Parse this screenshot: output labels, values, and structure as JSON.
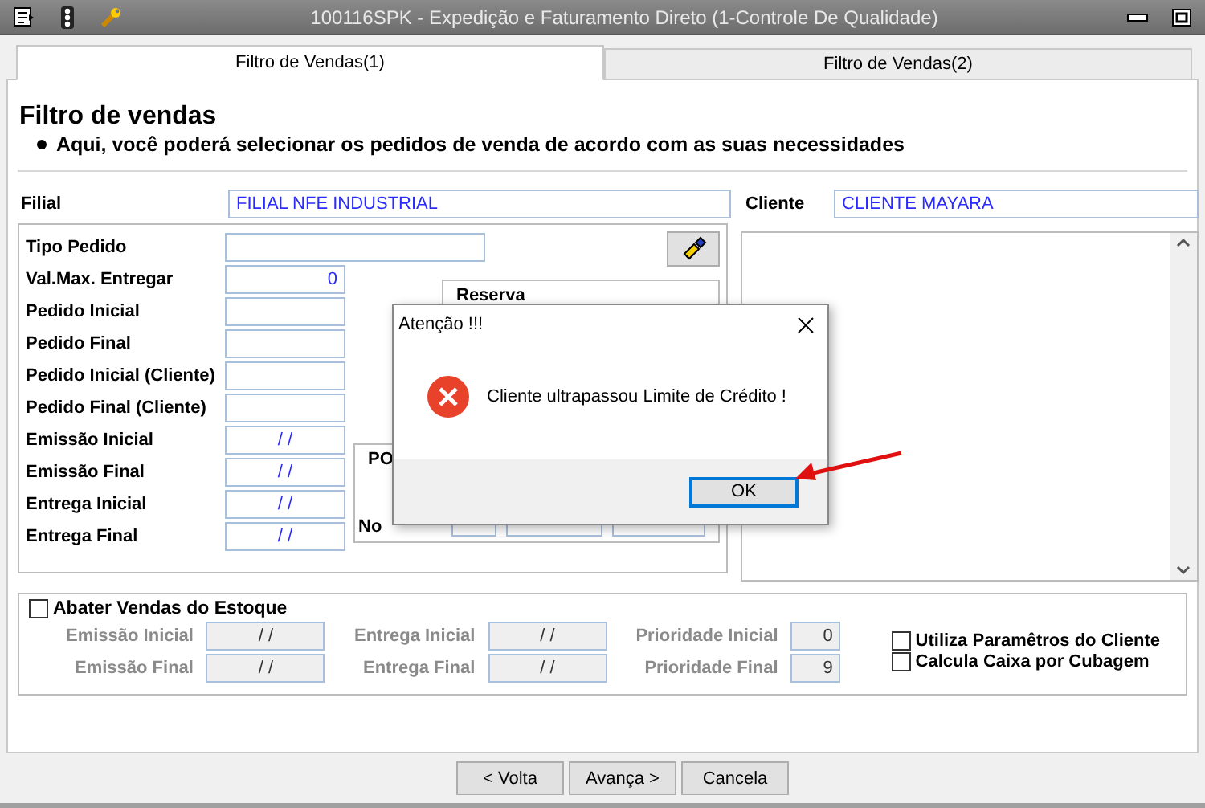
{
  "window": {
    "title": "100116SPK - Expedição e Faturamento Direto (1-Controle De Qualidade)"
  },
  "tabs": [
    {
      "label": "Filtro de Vendas(1)",
      "selected": true
    },
    {
      "label": "Filtro de Vendas(2)",
      "selected": false
    }
  ],
  "header": {
    "title": "Filtro de vendas",
    "bullet": "Aqui, você poderá selecionar os pedidos de venda de acordo com as suas necessidades"
  },
  "filial": {
    "label": "Filial",
    "value": "FILIAL NFE INDUSTRIAL"
  },
  "cliente": {
    "label": "Cliente",
    "value": "CLIENTE MAYARA"
  },
  "order_filters": [
    {
      "label": "Tipo Pedido",
      "kind": "wide"
    },
    {
      "label": "Val.Max. Entregar",
      "value": "0",
      "kind": "number"
    },
    {
      "label": "Pedido Inicial",
      "kind": "text"
    },
    {
      "label": "Pedido Final",
      "kind": "text"
    },
    {
      "label": "Pedido Inicial (Cliente)",
      "kind": "text"
    },
    {
      "label": "Pedido Final (Cliente)",
      "kind": "text"
    },
    {
      "label": "Emissão Inicial",
      "value": "/ /",
      "kind": "date"
    },
    {
      "label": "Emissão Final",
      "value": "/ /",
      "kind": "date"
    },
    {
      "label": "Entrega Inicial",
      "value": "/ /",
      "kind": "date"
    },
    {
      "label": "Entrega Final",
      "value": "/ /",
      "kind": "date"
    }
  ],
  "reserva": {
    "title": "Reserva"
  },
  "group_2": {
    "title": "PO",
    "label_1": "No"
  },
  "stock": {
    "label": "Abater Vendas do Estoque",
    "checked": false,
    "ranges": [
      {
        "label": "Emissão Inicial",
        "value": "/ /",
        "kind": "date",
        "disabled": true
      },
      {
        "label": "Entrega Inicial",
        "value": "/ /",
        "kind": "date",
        "disabled": true
      },
      {
        "label": "Prioridade Inicial",
        "value": "0",
        "kind": "number",
        "disabled": true
      },
      {
        "label": "Emissão Final",
        "value": "/ /",
        "kind": "date",
        "disabled": true
      },
      {
        "label": "Entrega Final",
        "value": "/ /",
        "kind": "date",
        "disabled": true
      },
      {
        "label": "Prioridade Final",
        "value": "9",
        "kind": "number",
        "disabled": true
      }
    ],
    "options": [
      {
        "label": "Utiliza Paramêtros do Cliente",
        "checked": false
      },
      {
        "label": "Calcula Caixa por Cubagem",
        "checked": false
      }
    ]
  },
  "buttons": [
    "< Volta",
    "Avança >",
    "Cancela"
  ],
  "dialog": {
    "title": "Atenção !!!",
    "message": "Cliente ultrapassou Limite de Crédito !",
    "button": "OK"
  }
}
